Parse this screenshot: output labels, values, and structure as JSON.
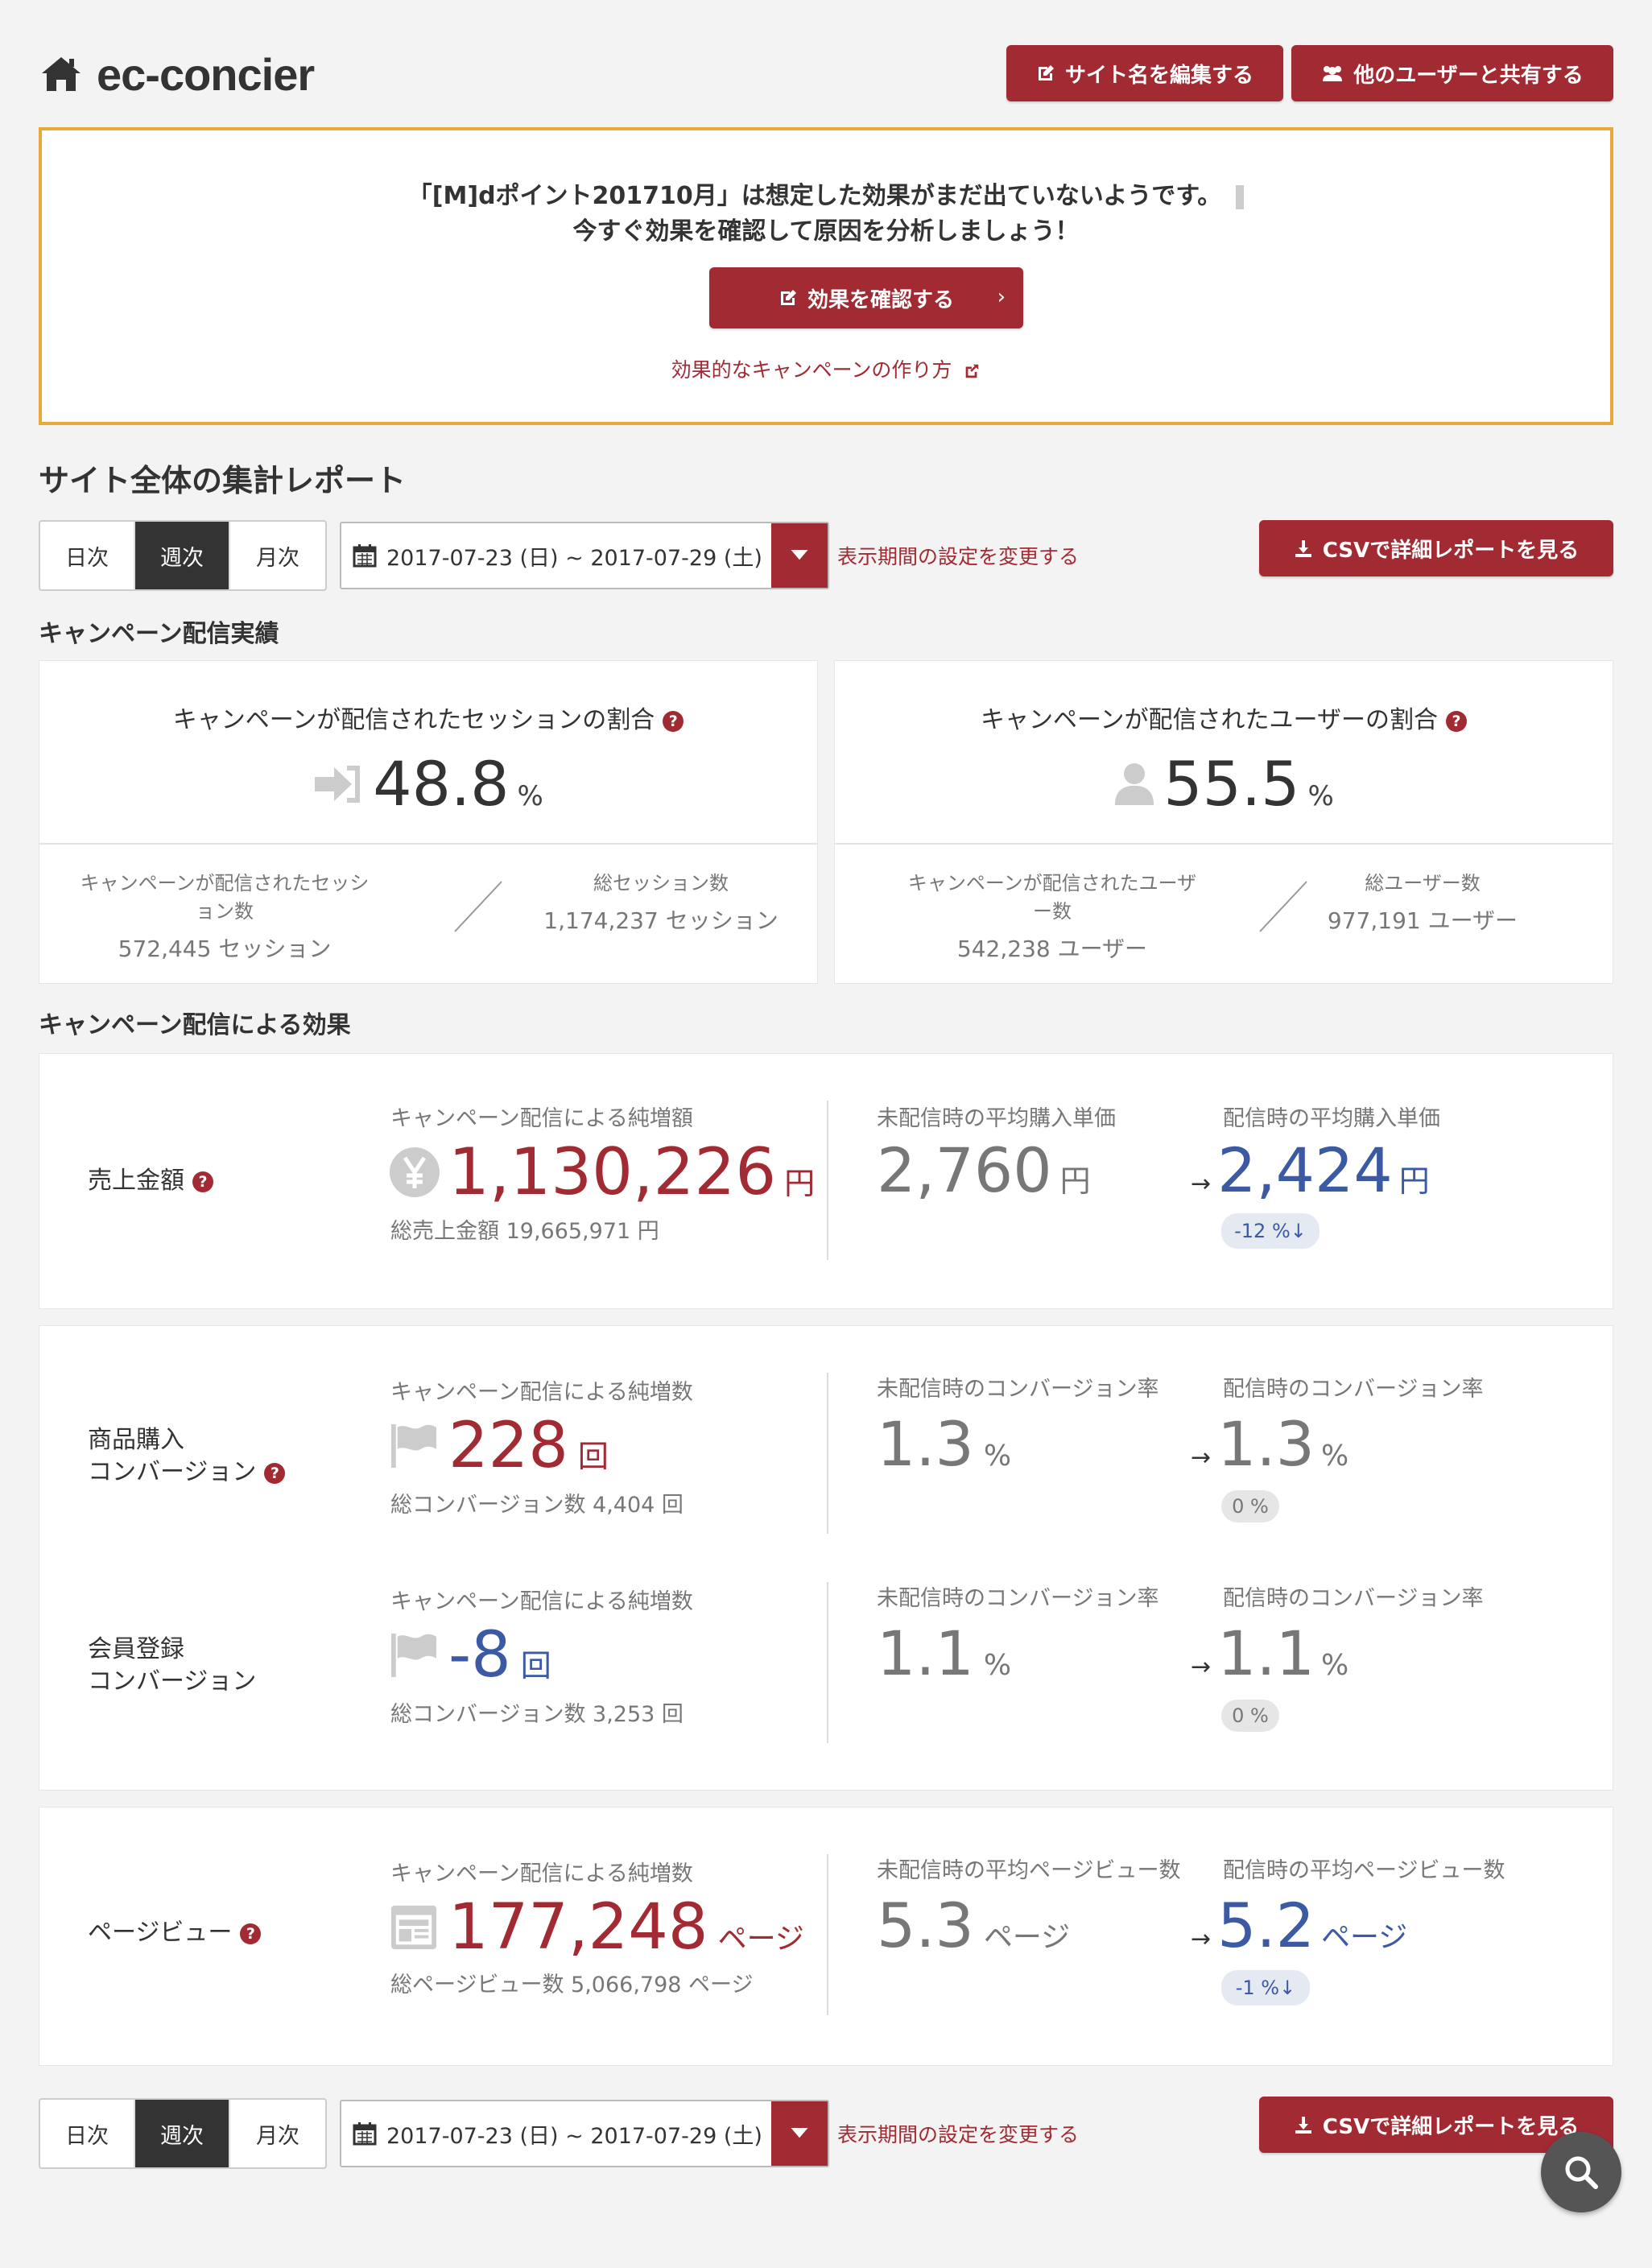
{
  "header": {
    "site_name": "ec-concier",
    "edit_site_label": "サイト名を編集する",
    "share_label": "他のユーザーと共有する"
  },
  "alert": {
    "line1": "「[M]dポイント201710月」は想定した効果がまだ出ていないようです。",
    "line2": "今すぐ効果を確認して原因を分析しましょう！",
    "button_label": "効果を確認する",
    "button_chevron": "›",
    "link_label": "効果的なキャンペーンの作り方"
  },
  "report": {
    "title": "サイト全体の集計レポート",
    "period_tabs": [
      "日次",
      "週次",
      "月次"
    ],
    "active_tab": "週次",
    "date_range": "2017-07-23 (日) ~ 2017-07-29 (土)",
    "change_period_label": "表示期間の設定を変更する",
    "csv_label": "CSVで詳細レポートを見る"
  },
  "delivery": {
    "heading": "キャンペーン配信実績",
    "session": {
      "title": "キャンペーンが配信されたセッションの割合",
      "pct": "48.8",
      "pct_unit": "%",
      "left_label": "キャンペーンが配信されたセッション数",
      "left_value": "572,445 セッション",
      "right_label": "総セッション数",
      "right_value": "1,174,237 セッション"
    },
    "user": {
      "title": "キャンペーンが配信されたユーザーの割合",
      "pct": "55.5",
      "pct_unit": "%",
      "left_label": "キャンペーンが配信されたユーザー数",
      "left_value": "542,238 ユーザー",
      "right_label": "総ユーザー数",
      "right_value": "977,191 ユーザー"
    }
  },
  "effect": {
    "heading": "キャンペーン配信による効果",
    "sales": {
      "label": "売上金額",
      "col1_label": "キャンペーン配信による純増額",
      "col1_value": "1,130,226",
      "col1_unit": "円",
      "col1_total": "総売上金額 19,665,971 円",
      "col2_label": "未配信時の平均購入単価",
      "col2_value": "2,760",
      "col2_unit": "円",
      "col3_label": "配信時の平均購入単価",
      "col3_value": "2,424",
      "col3_unit": "円",
      "col3_change": "-12 %↓"
    },
    "purchase": {
      "label_line1": "商品購入",
      "label_line2": "コンバージョン",
      "col1_label": "キャンペーン配信による純増数",
      "col1_value": "228",
      "col1_unit": "回",
      "col1_total": "総コンバージョン数 4,404 回",
      "col2_label": "未配信時のコンバージョン率",
      "col2_value": "1.3",
      "col2_unit": "%",
      "col3_label": "配信時のコンバージョン率",
      "col3_value": "1.3",
      "col3_unit": "%",
      "col3_change": "0 %"
    },
    "signup": {
      "label_line1": "会員登録",
      "label_line2": "コンバージョン",
      "col1_label": "キャンペーン配信による純増数",
      "col1_value": "-8",
      "col1_unit": "回",
      "col1_total": "総コンバージョン数 3,253 回",
      "col2_label": "未配信時のコンバージョン率",
      "col2_value": "1.1",
      "col2_unit": "%",
      "col3_label": "配信時のコンバージョン率",
      "col3_value": "1.1",
      "col3_unit": "%",
      "col3_change": "0 %"
    },
    "pageview": {
      "label": "ページビュー",
      "col1_label": "キャンペーン配信による純増数",
      "col1_value": "177,248",
      "col1_unit": "ページ",
      "col1_total": "総ページビュー数 5,066,798 ページ",
      "col2_label": "未配信時の平均ページビュー数",
      "col2_value": "5.3",
      "col2_unit": "ページ",
      "col3_label": "配信時の平均ページビュー数",
      "col3_value": "5.2",
      "col3_unit": "ページ",
      "col3_change": "-1 %↓"
    },
    "arrow": "→",
    "help_mark": "?"
  },
  "colors": {
    "accent": "#a12a33",
    "alert_border": "#e8a83c",
    "positive_blue": "#3b5aa3",
    "background": "#f3f3f3"
  },
  "icons": [
    "home-icon",
    "edit-icon",
    "users-icon",
    "calendar-icon",
    "caret-down-icon",
    "download-icon",
    "external-link-icon",
    "sign-in-icon",
    "user-icon",
    "yen-icon",
    "flag-icon",
    "browser-icon",
    "help-icon",
    "search-icon"
  ]
}
